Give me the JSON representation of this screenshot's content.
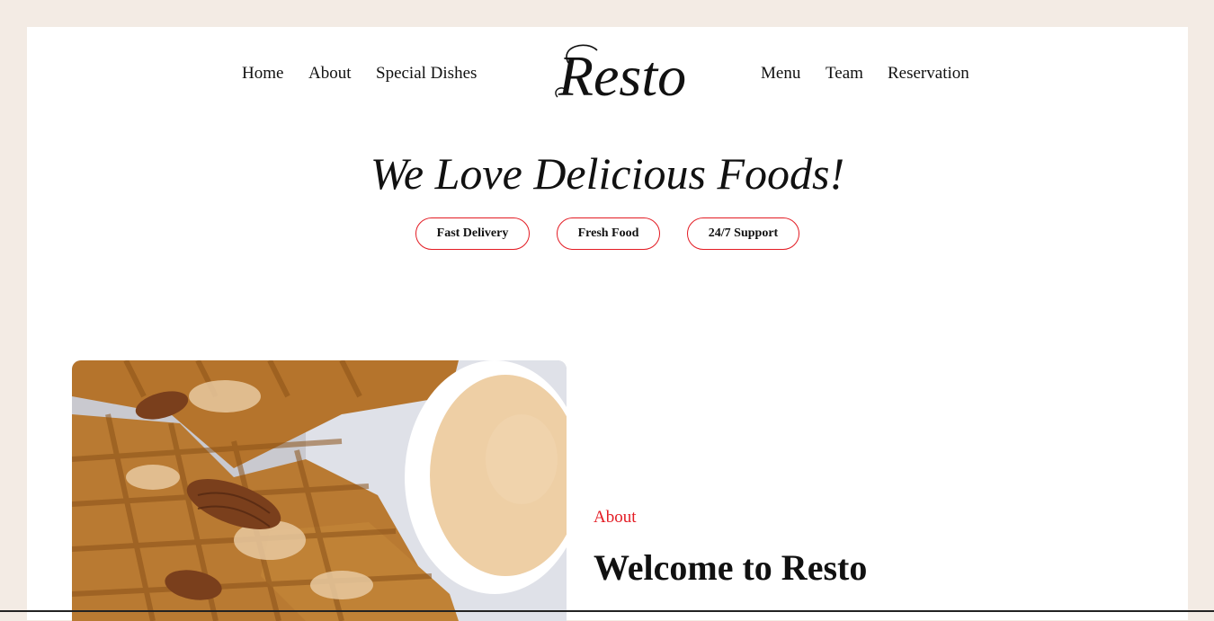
{
  "header": {
    "logo_text": "Resto",
    "nav_left": [
      {
        "label": "Home"
      },
      {
        "label": "About"
      },
      {
        "label": "Special Dishes"
      }
    ],
    "nav_right": [
      {
        "label": "Menu"
      },
      {
        "label": "Team"
      },
      {
        "label": "Reservation"
      }
    ]
  },
  "hero": {
    "title": "We Love Delicious Foods!",
    "features": [
      {
        "label": "Fast Delivery"
      },
      {
        "label": "Fresh Food"
      },
      {
        "label": "24/7 Support"
      }
    ]
  },
  "about": {
    "eyebrow": "About",
    "title": "Welcome to Resto",
    "image": "waffles-with-pecans-and-dipping-sauce"
  },
  "colors": {
    "accent": "#e31b23",
    "page_background": "#f3ebe4",
    "content_background": "#ffffff",
    "text": "#111111"
  }
}
